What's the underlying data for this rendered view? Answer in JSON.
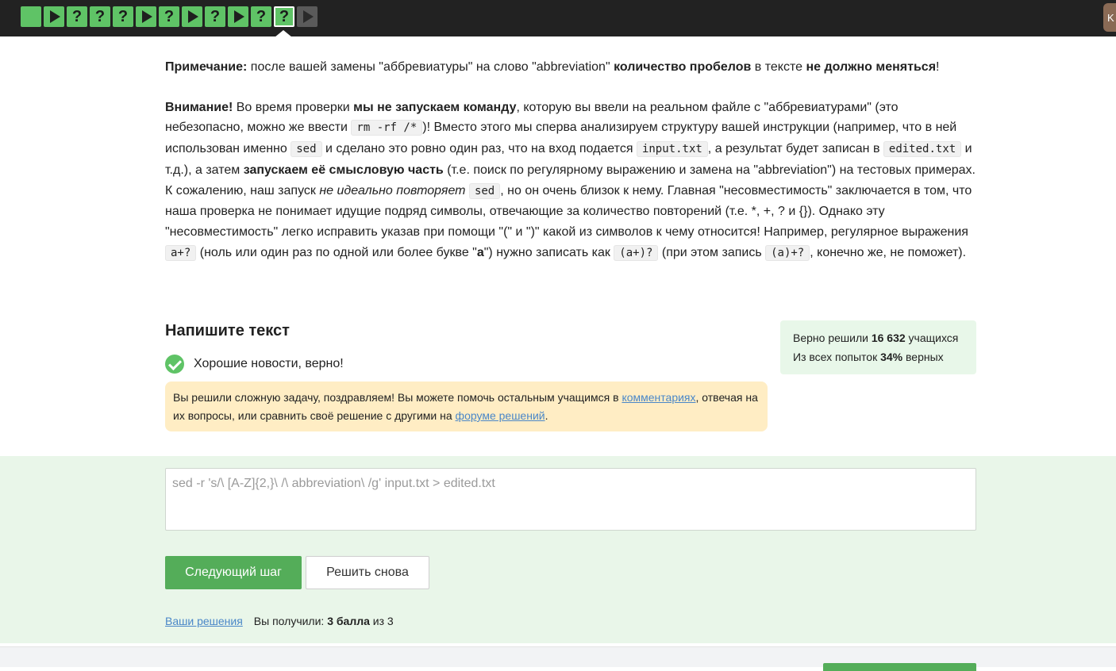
{
  "topbar": {
    "steps": [
      "",
      "▶",
      "?",
      "?",
      "?",
      "▶",
      "?",
      "▶",
      "?",
      "▶",
      "?",
      "?",
      "▶"
    ],
    "avatar_letter": "K"
  },
  "note": {
    "label": "Примечание:",
    "text1": " после вашей замены \"аббревиатуры\" на слово \"abbreviation\" ",
    "bold1": "количество пробелов",
    "text2": " в тексте ",
    "bold2": "не должно меняться",
    "text3": "!"
  },
  "warning": {
    "label": "Внимание!",
    "t1": " Во время проверки ",
    "b1": "мы не запускаем команду",
    "t2": ", которую вы ввели на реальном файле с \"аббревиатурами\" (это небезопасно, можно же ввести ",
    "c1": "rm -rf /*",
    "t3": ")! Вместо этого мы сперва анализируем структуру вашей инструкции (например, что в ней использован именно ",
    "c2": "sed",
    "t4": " и сделано это ровно один раз, что на вход подается ",
    "c3": "input.txt",
    "t5": ", а результат будет записан в ",
    "c4": "edited.txt",
    "t6": " и т.д.), а затем ",
    "b2": "запускаем её смысловую часть",
    "t7": " (т.е. поиск по регулярному выражению и замена на \"abbreviation\") на тестовых примерах.",
    "t8": "К сожалению, наш запуск ",
    "i1": "не идеально повторяет",
    "c5": "sed",
    "t9": ", но он очень близок к нему. Главная \"несовместимость\" заключается в том, что наша проверка не понимает идущие подряд символы, отвечающие за количество повторений (т.е. *, +, ? и {}). Однако эту \"несовместимость\" легко исправить указав при помощи \"(\" и \")\" какой из символов к чему относится! Например, регулярное выражения ",
    "c6": "a+?",
    "t10": " (ноль или один раз по одной или более букве \"",
    "b3": "a",
    "t11": "\") нужно записать как ",
    "c7": "(a+)?",
    "t12": " (при этом запись ",
    "c8": "(a)+?",
    "t13": ", конечно же, не поможет)."
  },
  "task": {
    "title": "Напишите текст",
    "result": "Хорошие новости, верно!"
  },
  "stats": {
    "line1_pre": "Верно решили ",
    "line1_num": "16 632",
    "line1_post": " учащихся",
    "line2_pre": "Из всех попыток ",
    "line2_num": "34%",
    "line2_post": " верных"
  },
  "congrats": {
    "t1": "Вы решили сложную задачу, поздравляем! Вы можете помочь остальным учащимся в ",
    "link1": "комментариях",
    "t2": ", отвечая на их вопросы, или сравнить своё решение с другими на ",
    "link2": "форуме решений",
    "t3": "."
  },
  "answer": {
    "value": "sed -r  's/\\ [A-Z]{2,}\\ /\\ abbreviation\\ /g' input.txt > edited.txt"
  },
  "buttons": {
    "next": "Следующий шаг",
    "retry": "Решить снова"
  },
  "footer": {
    "solutions_link": "Ваши решения",
    "score_pre": "Вы получили: ",
    "score_bold": "3 балла",
    "score_post": " из 3"
  },
  "colors": {
    "accent_green": "#54ad59",
    "step_green": "#5fc366",
    "topbar": "#222222",
    "congrats_bg": "#ffedc4",
    "answer_zone_bg": "#e9f6e9"
  }
}
